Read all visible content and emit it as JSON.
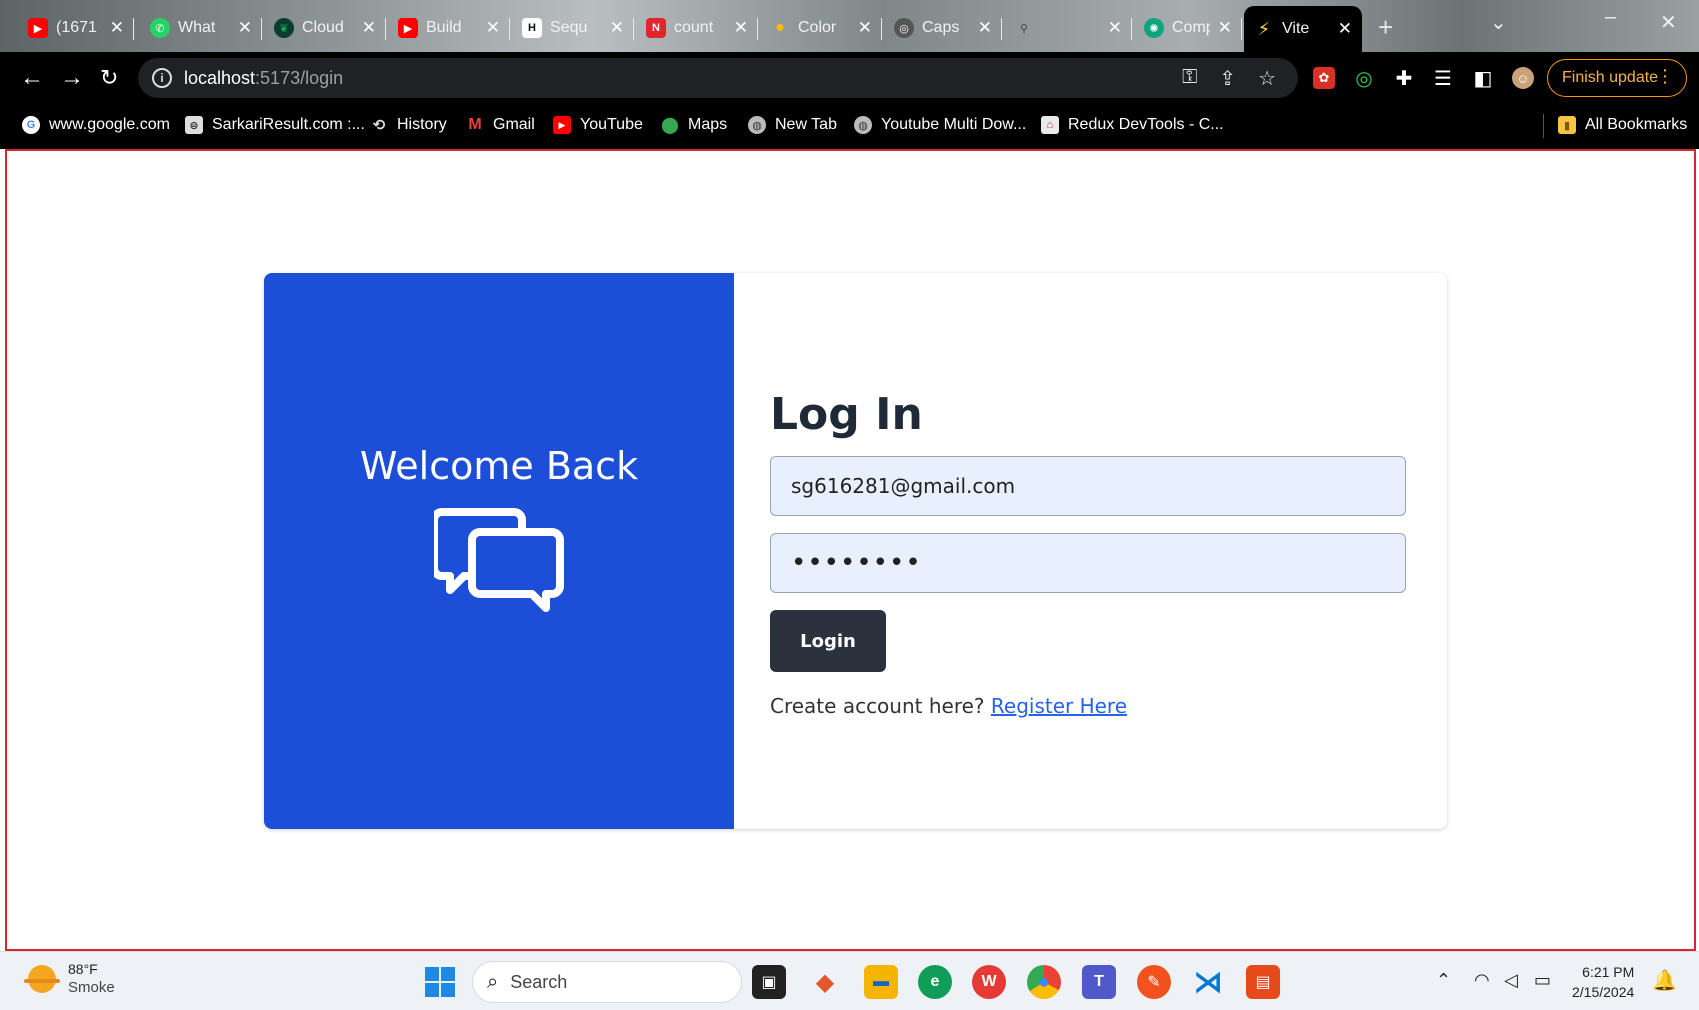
{
  "browser": {
    "tabs": [
      {
        "label": "(1671",
        "icon": "youtube-icon",
        "color": "#ff0000"
      },
      {
        "label": "What",
        "icon": "whatsapp-icon",
        "color": "#25d366"
      },
      {
        "label": "Cloud",
        "icon": "mongodb-leaf-icon",
        "color": "#13aa52"
      },
      {
        "label": "Build",
        "icon": "youtube-icon",
        "color": "#ff0000"
      },
      {
        "label": "Sequ",
        "icon": "hashnode-icon",
        "color": "#111111"
      },
      {
        "label": "count",
        "icon": "notion-icon",
        "color": "#e0252d"
      },
      {
        "label": "Color",
        "icon": "maps-pin-icon",
        "color": "#fbbc04"
      },
      {
        "label": "Caps",
        "icon": "globe-icon",
        "color": "#666666"
      },
      {
        "label": "",
        "icon": "pin-icon",
        "color": "#777777"
      },
      {
        "label": "Comp",
        "icon": "chatgpt-icon",
        "color": "#10a37f"
      },
      {
        "label": "Vite",
        "icon": "vite-icon",
        "color": "#9b5cff",
        "active": true
      }
    ],
    "new_tab_symbol": "+",
    "address": {
      "host": "localhost",
      "path": ":5173/login"
    },
    "finish_update_label": "Finish update",
    "bookmarks": [
      {
        "label": "www.google.com",
        "icon": "google-icon",
        "color": "#ffffff"
      },
      {
        "label": "SarkariResult.com :...",
        "icon": "sarkari-icon",
        "color": "#cccccc"
      },
      {
        "label": "History",
        "icon": "history-icon",
        "color": "#cccccc"
      },
      {
        "label": "Gmail",
        "icon": "gmail-icon",
        "color": "#ea4335"
      },
      {
        "label": "YouTube",
        "icon": "youtube-icon",
        "color": "#ff0000"
      },
      {
        "label": "Maps",
        "icon": "maps-pin-icon",
        "color": "#34a853"
      },
      {
        "label": "New Tab",
        "icon": "globe-icon",
        "color": "#cccccc"
      },
      {
        "label": "Youtube Multi Dow...",
        "icon": "globe-icon",
        "color": "#cccccc"
      },
      {
        "label": "Redux DevTools - C...",
        "icon": "store-icon",
        "color": "#e8eaed"
      }
    ],
    "all_bookmarks_label": "All Bookmarks"
  },
  "page": {
    "welcome_text": "Welcome Back",
    "login_title": "Log In",
    "email_value": "sg616281@gmail.com",
    "password_value": "••••••••",
    "login_button": "Login",
    "register_prompt": "Create account here?",
    "register_link": "Register Here",
    "accent_color": "#1d4ed8"
  },
  "taskbar": {
    "temperature": "88°F",
    "condition": "Smoke",
    "search_placeholder": "Search",
    "time": "6:21 PM",
    "date": "2/15/2024"
  }
}
